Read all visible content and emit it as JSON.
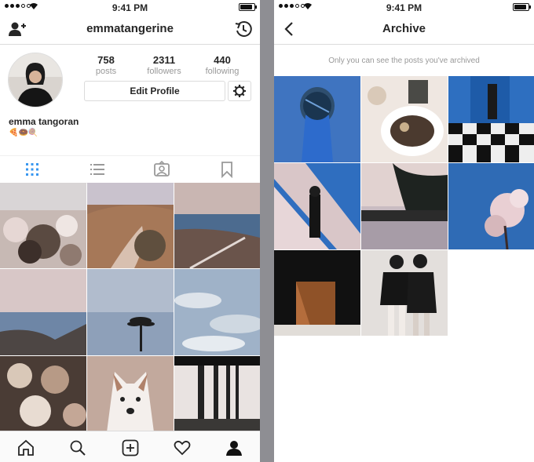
{
  "left": {
    "status": {
      "time": "9:41 PM"
    },
    "header": {
      "username": "emmatangerine",
      "add_icon": "add-person-icon",
      "archive_icon": "archive-clock-icon"
    },
    "stats": [
      {
        "value": "758",
        "label": "posts"
      },
      {
        "value": "2311",
        "label": "followers"
      },
      {
        "value": "440",
        "label": "following"
      }
    ],
    "edit_profile_label": "Edit Profile",
    "name": "emma tangoran",
    "bio": "🍕🍩🍭",
    "tabs": [
      "grid-icon",
      "list-icon",
      "tagged-icon",
      "saved-icon"
    ],
    "bottom_nav": [
      "home-icon",
      "search-icon",
      "add-icon",
      "heart-icon",
      "profile-icon"
    ]
  },
  "right": {
    "status": {
      "time": "9:41 PM"
    },
    "header": {
      "title": "Archive",
      "back_icon": "back-chevron-icon"
    },
    "notice": "Only you can see the posts you've archived"
  },
  "colors": {
    "accent_blue": "#3897f0",
    "text": "#262626",
    "muted": "#999999",
    "border": "#dbdbdb"
  }
}
